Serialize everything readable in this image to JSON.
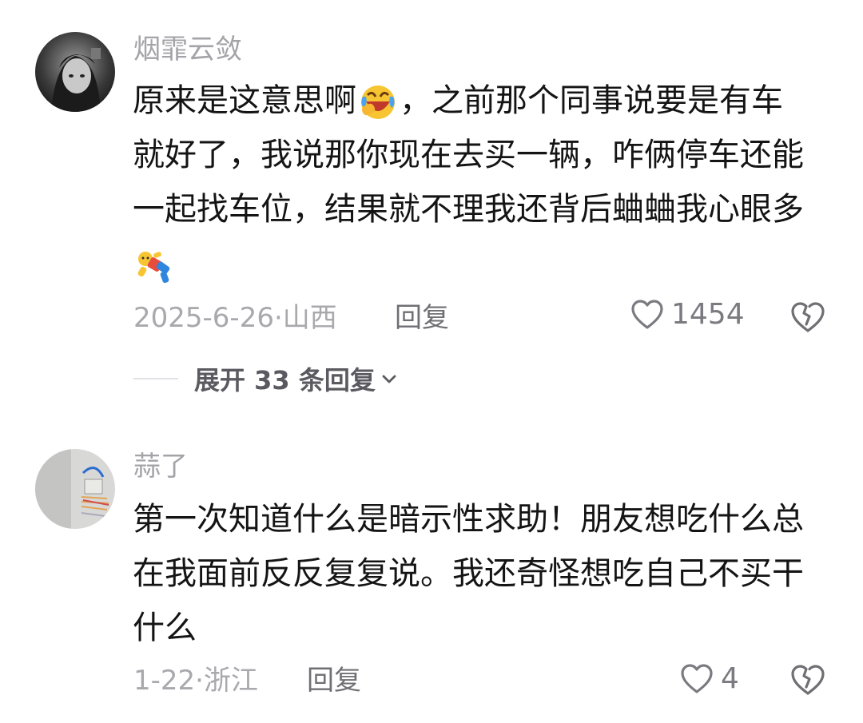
{
  "comments": [
    {
      "username": "烟霏云敛",
      "lines": [
        {
          "before": "原来是这意思啊",
          "after": "，之前那个同事说要是有车"
        },
        {
          "text": "就好了，我说那你现在去买一辆，咋俩停车还能"
        },
        {
          "text": "一起找车位，结果就不理我还背后蛐蛐我心眼多"
        }
      ],
      "emoji_inline": "laughing-crying-emoji",
      "emoji_trailing": "fallen-person-emoji",
      "date": "2025-6-26",
      "location": "山西",
      "reply_label": "回复",
      "likes": "1454"
    },
    {
      "username": "蒜了",
      "lines": [
        {
          "text": "第一次知道什么是暗示性求助！朋友想吃什么总"
        },
        {
          "text": "在我面前反反复复说。我还奇怪想吃自己不买干"
        },
        {
          "text": "什么"
        }
      ],
      "date": "1-22",
      "location": "浙江",
      "reply_label": "回复",
      "likes": "4"
    }
  ],
  "expand": {
    "label": "展开 33 条回复"
  },
  "colors": {
    "text": "#141414",
    "muted": "#a8a8ad",
    "accent": "#5a5a60"
  },
  "icons": {
    "like": "heart-outline-icon",
    "dislike": "broken-heart-icon",
    "chevron": "chevron-down-icon"
  }
}
